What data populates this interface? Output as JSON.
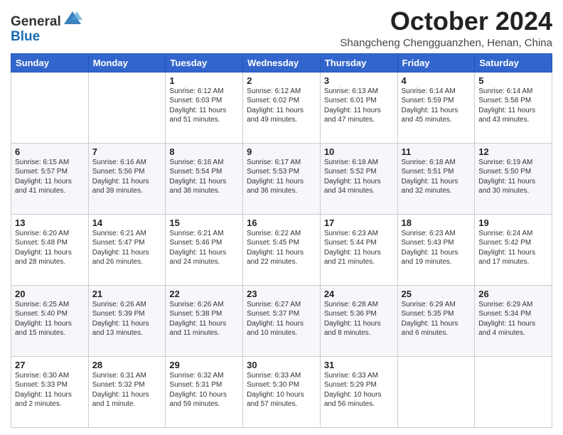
{
  "header": {
    "logo_line1": "General",
    "logo_line2": "Blue",
    "month": "October 2024",
    "location": "Shangcheng Chengguanzhen, Henan, China"
  },
  "days_of_week": [
    "Sunday",
    "Monday",
    "Tuesday",
    "Wednesday",
    "Thursday",
    "Friday",
    "Saturday"
  ],
  "weeks": [
    [
      {
        "day": "",
        "info": ""
      },
      {
        "day": "",
        "info": ""
      },
      {
        "day": "1",
        "info": "Sunrise: 6:12 AM\nSunset: 6:03 PM\nDaylight: 11 hours and 51 minutes."
      },
      {
        "day": "2",
        "info": "Sunrise: 6:12 AM\nSunset: 6:02 PM\nDaylight: 11 hours and 49 minutes."
      },
      {
        "day": "3",
        "info": "Sunrise: 6:13 AM\nSunset: 6:01 PM\nDaylight: 11 hours and 47 minutes."
      },
      {
        "day": "4",
        "info": "Sunrise: 6:14 AM\nSunset: 5:59 PM\nDaylight: 11 hours and 45 minutes."
      },
      {
        "day": "5",
        "info": "Sunrise: 6:14 AM\nSunset: 5:58 PM\nDaylight: 11 hours and 43 minutes."
      }
    ],
    [
      {
        "day": "6",
        "info": "Sunrise: 6:15 AM\nSunset: 5:57 PM\nDaylight: 11 hours and 41 minutes."
      },
      {
        "day": "7",
        "info": "Sunrise: 6:16 AM\nSunset: 5:56 PM\nDaylight: 11 hours and 39 minutes."
      },
      {
        "day": "8",
        "info": "Sunrise: 6:16 AM\nSunset: 5:54 PM\nDaylight: 11 hours and 38 minutes."
      },
      {
        "day": "9",
        "info": "Sunrise: 6:17 AM\nSunset: 5:53 PM\nDaylight: 11 hours and 36 minutes."
      },
      {
        "day": "10",
        "info": "Sunrise: 6:18 AM\nSunset: 5:52 PM\nDaylight: 11 hours and 34 minutes."
      },
      {
        "day": "11",
        "info": "Sunrise: 6:18 AM\nSunset: 5:51 PM\nDaylight: 11 hours and 32 minutes."
      },
      {
        "day": "12",
        "info": "Sunrise: 6:19 AM\nSunset: 5:50 PM\nDaylight: 11 hours and 30 minutes."
      }
    ],
    [
      {
        "day": "13",
        "info": "Sunrise: 6:20 AM\nSunset: 5:48 PM\nDaylight: 11 hours and 28 minutes."
      },
      {
        "day": "14",
        "info": "Sunrise: 6:21 AM\nSunset: 5:47 PM\nDaylight: 11 hours and 26 minutes."
      },
      {
        "day": "15",
        "info": "Sunrise: 6:21 AM\nSunset: 5:46 PM\nDaylight: 11 hours and 24 minutes."
      },
      {
        "day": "16",
        "info": "Sunrise: 6:22 AM\nSunset: 5:45 PM\nDaylight: 11 hours and 22 minutes."
      },
      {
        "day": "17",
        "info": "Sunrise: 6:23 AM\nSunset: 5:44 PM\nDaylight: 11 hours and 21 minutes."
      },
      {
        "day": "18",
        "info": "Sunrise: 6:23 AM\nSunset: 5:43 PM\nDaylight: 11 hours and 19 minutes."
      },
      {
        "day": "19",
        "info": "Sunrise: 6:24 AM\nSunset: 5:42 PM\nDaylight: 11 hours and 17 minutes."
      }
    ],
    [
      {
        "day": "20",
        "info": "Sunrise: 6:25 AM\nSunset: 5:40 PM\nDaylight: 11 hours and 15 minutes."
      },
      {
        "day": "21",
        "info": "Sunrise: 6:26 AM\nSunset: 5:39 PM\nDaylight: 11 hours and 13 minutes."
      },
      {
        "day": "22",
        "info": "Sunrise: 6:26 AM\nSunset: 5:38 PM\nDaylight: 11 hours and 11 minutes."
      },
      {
        "day": "23",
        "info": "Sunrise: 6:27 AM\nSunset: 5:37 PM\nDaylight: 11 hours and 10 minutes."
      },
      {
        "day": "24",
        "info": "Sunrise: 6:28 AM\nSunset: 5:36 PM\nDaylight: 11 hours and 8 minutes."
      },
      {
        "day": "25",
        "info": "Sunrise: 6:29 AM\nSunset: 5:35 PM\nDaylight: 11 hours and 6 minutes."
      },
      {
        "day": "26",
        "info": "Sunrise: 6:29 AM\nSunset: 5:34 PM\nDaylight: 11 hours and 4 minutes."
      }
    ],
    [
      {
        "day": "27",
        "info": "Sunrise: 6:30 AM\nSunset: 5:33 PM\nDaylight: 11 hours and 2 minutes."
      },
      {
        "day": "28",
        "info": "Sunrise: 6:31 AM\nSunset: 5:32 PM\nDaylight: 11 hours and 1 minute."
      },
      {
        "day": "29",
        "info": "Sunrise: 6:32 AM\nSunset: 5:31 PM\nDaylight: 10 hours and 59 minutes."
      },
      {
        "day": "30",
        "info": "Sunrise: 6:33 AM\nSunset: 5:30 PM\nDaylight: 10 hours and 57 minutes."
      },
      {
        "day": "31",
        "info": "Sunrise: 6:33 AM\nSunset: 5:29 PM\nDaylight: 10 hours and 56 minutes."
      },
      {
        "day": "",
        "info": ""
      },
      {
        "day": "",
        "info": ""
      }
    ]
  ]
}
